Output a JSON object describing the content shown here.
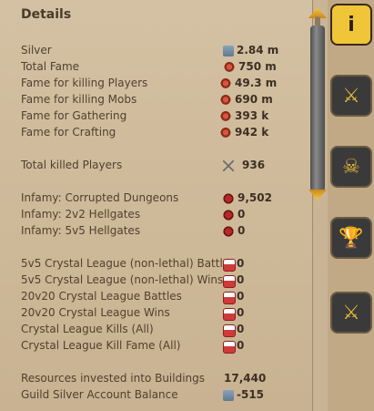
{
  "title": "Details",
  "rows": [
    {
      "label": "Silver",
      "icon": "silver-icon",
      "value": "2.84 m"
    },
    {
      "label": "Total Fame",
      "icon": "fame-icon",
      "value": "750 m"
    },
    {
      "label": "Fame for killing Players",
      "icon": "fame-icon",
      "value": "49.3 m"
    },
    {
      "label": "Fame for killing Mobs",
      "icon": "fame-icon",
      "value": "690 m"
    },
    {
      "label": "Fame for Gathering",
      "icon": "fame-icon",
      "value": "393 k"
    },
    {
      "label": "Fame for Crafting",
      "icon": "fame-icon",
      "value": "942 k"
    },
    {
      "label": "Total killed Players",
      "icon": "swords-icon",
      "value": "936"
    },
    {
      "label": "Infamy: Corrupted Dungeons",
      "icon": "infamy-icon",
      "value": "9,502"
    },
    {
      "label": "Infamy: 2v2 Hellgates",
      "icon": "infamy-icon",
      "value": "0"
    },
    {
      "label": "Infamy: 5v5 Hellgates",
      "icon": "infamy-icon",
      "value": "0"
    },
    {
      "label": "5v5 Crystal League (non-lethal) Battles",
      "icon": "crystal-league-icon",
      "value": "0"
    },
    {
      "label": "5v5 Crystal League (non-lethal) Wins",
      "icon": "crystal-league-icon",
      "value": "0"
    },
    {
      "label": "20v20 Crystal League Battles",
      "icon": "crystal-league-icon",
      "value": "0"
    },
    {
      "label": "20v20 Crystal League Wins",
      "icon": "crystal-league-icon",
      "value": "0"
    },
    {
      "label": "Crystal League Kills (All)",
      "icon": "crystal-league-icon",
      "value": "0"
    },
    {
      "label": "Crystal League Kill Fame (All)",
      "icon": "crystal-league-icon",
      "value": "0"
    },
    {
      "label": "Resources invested into Buildings",
      "icon": "",
      "value": "17,440"
    },
    {
      "label": "Guild Silver Account Balance",
      "icon": "silver-icon",
      "value": "-515"
    }
  ],
  "tabs": [
    {
      "name": "info",
      "symbol": "i"
    },
    {
      "name": "combat",
      "symbol": "⚔"
    },
    {
      "name": "pvp-kills",
      "symbol": "☠"
    },
    {
      "name": "achievements",
      "symbol": "🏆"
    },
    {
      "name": "territory",
      "symbol": "⚔"
    }
  ]
}
